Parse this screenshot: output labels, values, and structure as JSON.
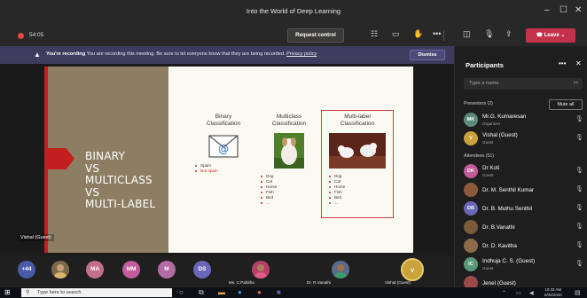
{
  "window": {
    "title": "Into the World of Deep Learning"
  },
  "toolbar": {
    "timer": "54:05",
    "request_control": "Request control",
    "leave": "Leave"
  },
  "banner": {
    "bold": "You're recording",
    "message": "You are recording this meeting. Be sure to let everyone know that they are being recorded.",
    "link": "Privacy policy",
    "dismiss": "Dismiss"
  },
  "slide": {
    "title_lines": [
      "BINARY",
      "VS",
      "MULTICLASS",
      "VS",
      "MULTI-LABEL"
    ],
    "columns": [
      {
        "title1": "Binary",
        "title2": "Classification",
        "items": [
          "Spam",
          "Not spam"
        ]
      },
      {
        "title1": "Multiclass",
        "title2": "Classification",
        "items": [
          "Dog",
          "Cat",
          "Horse",
          "Fish",
          "Bird",
          "..."
        ]
      },
      {
        "title1": "Multi-label",
        "title2": "Classification",
        "items": [
          "Dog",
          "Cat",
          "Horse",
          "Fish",
          "Bird",
          "..."
        ]
      }
    ]
  },
  "stage": {
    "presenter_name": "Vishal (Guest)"
  },
  "strip": {
    "overflow": "+44",
    "avatars": [
      {
        "initials": "MA",
        "color": "#c46f89"
      },
      {
        "initials": "MM",
        "color": "#c45b9a"
      },
      {
        "initials": "M",
        "color": "#b46aa4"
      },
      {
        "initials": "DS",
        "color": "#6b67b8"
      },
      {
        "initials": "V",
        "color": "#c9a23c"
      }
    ],
    "names": [
      "Ms. C.Pabitha",
      "Dr. R.Vanathi",
      "Vishal (Guest)"
    ]
  },
  "panel": {
    "title": "Participants",
    "search_placeholder": "Type a name",
    "presenters_label": "Presenters (2)",
    "mute_all": "Mute all",
    "presenters": [
      {
        "name": "Mr.G. Kumaresan",
        "role": "Organizer",
        "color": "#5d8a7a",
        "initials": "MK"
      },
      {
        "name": "Vishal (Guest)",
        "role": "Guest",
        "color": "#c9a23c",
        "initials": "V"
      }
    ],
    "attendees_label": "Attendees (51)",
    "attendees": [
      {
        "name": "Dr Koti",
        "role": "Guest",
        "color": "#c45b9a",
        "initials": "DK"
      },
      {
        "name": "Dr. M. Senthil Kumar",
        "role": "",
        "color": "#8c5a3a",
        "initials": ""
      },
      {
        "name": "Dr. B. Muthu Senthil",
        "role": "",
        "color": "#6b67b8",
        "initials": "DB"
      },
      {
        "name": "Dr. B.Vanathi",
        "role": "",
        "color": "#7a5a3a",
        "initials": ""
      },
      {
        "name": "Dr. D. Kavitha",
        "role": "",
        "color": "#8a6a4a",
        "initials": ""
      },
      {
        "name": "Indhuja C. S. (Guest)",
        "role": "Guest",
        "color": "#5a9a7a",
        "initials": "IC"
      },
      {
        "name": "Jenel (Guest)",
        "role": "",
        "color": "#9a4a4a",
        "initials": ""
      }
    ]
  },
  "taskbar": {
    "search_placeholder": "Type here to search",
    "time": "10:33 AM",
    "date": "6/30/2020"
  }
}
